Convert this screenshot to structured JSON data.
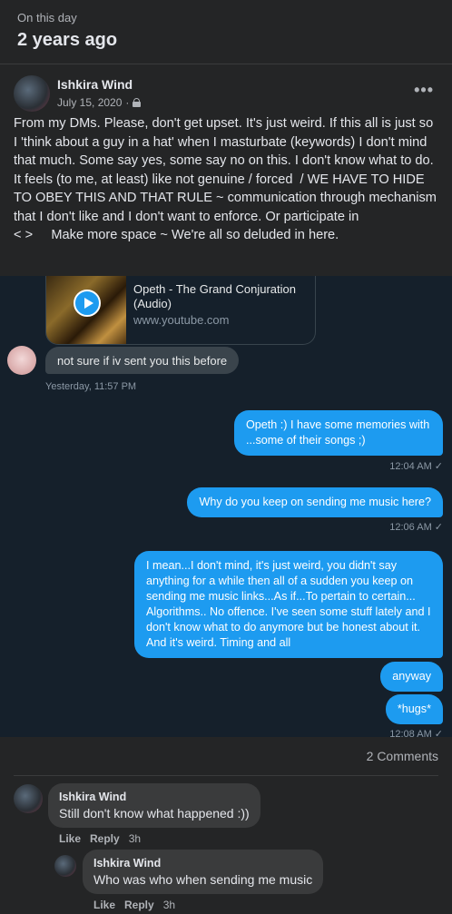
{
  "memory": {
    "label": "On this day",
    "title": "2 years ago"
  },
  "post": {
    "author": "Ishkira Wind",
    "date": "July 15, 2020",
    "more": "•••",
    "text": "From my DMs. Please, don't get upset. It's just weird. If this all is just so I 'think about a guy in a hat' when I masturbate (keywords) I don't mind that much. Some say yes, some say no on this. I don't know what to do. It feels (to me, at least) like not genuine / forced  / WE HAVE TO HIDE TO OBEY THIS AND THAT RULE ~ communication through mechanism that I don't like and I don't want to enforce. Or participate in",
    "text2": "< >     Make more space ~ We're all so deluded in here."
  },
  "dm": {
    "link_card": {
      "title": "Opeth - The Grand Conjuration (Audio)",
      "domain": "www.youtube.com"
    },
    "received": {
      "text": "not sure if iv sent you this before",
      "time": "Yesterday, 11:57 PM"
    },
    "sent": [
      {
        "text": "Opeth :) I have some memories with ...some of their songs ;)",
        "time": "12:04 AM ✓"
      },
      {
        "text": "Why do you keep on sending me music here?",
        "time": "12:06 AM ✓"
      },
      {
        "text": "I mean...I don't mind, it's just weird, you didn't say anything for a while then all of a sudden you keep on sending me music links...As if...To pertain to certain... Algorithms.. No offence. I've seen some stuff lately and I don't know what to do anymore but be honest about it. And it's weird. Timing and all",
        "time": ""
      },
      {
        "text": "anyway",
        "time": ""
      },
      {
        "text": "*hugs*",
        "time": "12:08 AM ✓"
      }
    ]
  },
  "comments": {
    "count": "2 Comments",
    "items": [
      {
        "author": "Ishkira Wind",
        "text": "Still don't know what happened :))",
        "like": "Like",
        "reply": "Reply",
        "time": "3h"
      },
      {
        "author": "Ishkira Wind",
        "text": "Who was who when sending me music",
        "like": "Like",
        "reply": "Reply",
        "time": "3h"
      }
    ]
  }
}
